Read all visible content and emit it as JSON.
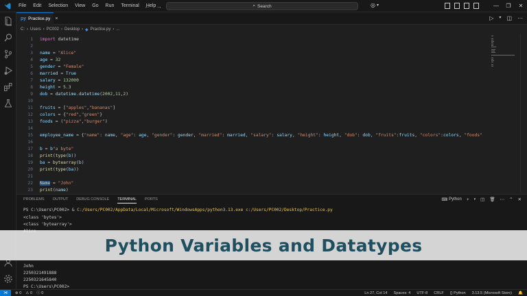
{
  "titlebar": {
    "menu": [
      "File",
      "Edit",
      "Selection",
      "View",
      "Go",
      "Run",
      "Terminal",
      "Help"
    ],
    "search_label": "Search"
  },
  "tab": {
    "label": "Practice.py",
    "icon_text": "py"
  },
  "breadcrumb": [
    "C:",
    "Users",
    "PC002",
    "Desktop",
    "Practice.py",
    "..."
  ],
  "editor": {
    "lines": [
      {
        "n": "1",
        "t": [
          [
            "kw",
            "import"
          ],
          [
            "code",
            " datetime"
          ]
        ]
      },
      {
        "n": "2",
        "t": []
      },
      {
        "n": "3",
        "t": [
          [
            "var",
            "name"
          ],
          [
            "code",
            " = "
          ],
          [
            "str",
            "\"Alice\""
          ]
        ]
      },
      {
        "n": "4",
        "t": [
          [
            "var",
            "age"
          ],
          [
            "code",
            " = "
          ],
          [
            "num",
            "32"
          ]
        ]
      },
      {
        "n": "5",
        "t": [
          [
            "var",
            "gender"
          ],
          [
            "code",
            " = "
          ],
          [
            "str",
            "\"Female\""
          ]
        ]
      },
      {
        "n": "6",
        "t": [
          [
            "var",
            "married"
          ],
          [
            "code",
            " = "
          ],
          [
            "var",
            "True"
          ]
        ]
      },
      {
        "n": "7",
        "t": [
          [
            "var",
            "salary"
          ],
          [
            "code",
            " = "
          ],
          [
            "num",
            "132000"
          ]
        ]
      },
      {
        "n": "8",
        "t": [
          [
            "var",
            "height"
          ],
          [
            "code",
            " = "
          ],
          [
            "num",
            "5.3"
          ]
        ]
      },
      {
        "n": "9",
        "t": [
          [
            "var",
            "dob"
          ],
          [
            "code",
            " = "
          ],
          [
            "var",
            "datetime"
          ],
          [
            "code",
            "."
          ],
          [
            "var",
            "datetime"
          ],
          [
            "code",
            "("
          ],
          [
            "num",
            "2002"
          ],
          [
            "code",
            ","
          ],
          [
            "num",
            "11"
          ],
          [
            "code",
            ","
          ],
          [
            "num",
            "2"
          ],
          [
            "code",
            ")"
          ]
        ]
      },
      {
        "n": "10",
        "t": []
      },
      {
        "n": "11",
        "t": [
          [
            "var",
            "fruits"
          ],
          [
            "code",
            " = ["
          ],
          [
            "str",
            "\"apples\""
          ],
          [
            "code",
            ","
          ],
          [
            "str",
            "\"bananas\""
          ],
          [
            "code",
            "]"
          ]
        ]
      },
      {
        "n": "12",
        "t": [
          [
            "var",
            "colors"
          ],
          [
            "code",
            " = {"
          ],
          [
            "str",
            "\"red\""
          ],
          [
            "code",
            ","
          ],
          [
            "str",
            "\"green\""
          ],
          [
            "code",
            "}"
          ]
        ]
      },
      {
        "n": "13",
        "t": [
          [
            "var",
            "foods"
          ],
          [
            "code",
            " = ("
          ],
          [
            "str",
            "\"pizza\""
          ],
          [
            "code",
            ","
          ],
          [
            "str",
            "\"burger\""
          ],
          [
            "code",
            ")"
          ]
        ]
      },
      {
        "n": "14",
        "t": []
      },
      {
        "n": "15",
        "t": [
          [
            "var",
            "employee_name"
          ],
          [
            "code",
            " = {"
          ],
          [
            "str",
            "\"name\""
          ],
          [
            "code",
            ": "
          ],
          [
            "var",
            "name"
          ],
          [
            "code",
            ", "
          ],
          [
            "str",
            "\"age\""
          ],
          [
            "code",
            ": "
          ],
          [
            "var",
            "age"
          ],
          [
            "code",
            ", "
          ],
          [
            "str",
            "\"gender\""
          ],
          [
            "code",
            ": "
          ],
          [
            "var",
            "gender"
          ],
          [
            "code",
            ", "
          ],
          [
            "str",
            "\"married\""
          ],
          [
            "code",
            ": "
          ],
          [
            "var",
            "married"
          ],
          [
            "code",
            ", "
          ],
          [
            "str",
            "\"salary\""
          ],
          [
            "code",
            ": "
          ],
          [
            "var",
            "salary"
          ],
          [
            "code",
            ", "
          ],
          [
            "str",
            "\"height\""
          ],
          [
            "code",
            ": "
          ],
          [
            "var",
            "height"
          ],
          [
            "code",
            ", "
          ],
          [
            "str",
            "\"dob\""
          ],
          [
            "code",
            ": "
          ],
          [
            "var",
            "dob"
          ],
          [
            "code",
            ", "
          ],
          [
            "str",
            "\"fruits\""
          ],
          [
            "code",
            ":"
          ],
          [
            "var",
            "fruits"
          ],
          [
            "code",
            ", "
          ],
          [
            "str",
            "\"colors\""
          ],
          [
            "code",
            ":"
          ],
          [
            "var",
            "colors"
          ],
          [
            "code",
            ", "
          ],
          [
            "str",
            "\"foods\""
          ]
        ]
      },
      {
        "n": "16",
        "t": []
      },
      {
        "n": "17",
        "t": [
          [
            "var",
            "b"
          ],
          [
            "code",
            " = "
          ],
          [
            "var",
            "b"
          ],
          [
            "str",
            "\"a byte\""
          ]
        ]
      },
      {
        "n": "18",
        "t": [
          [
            "fn",
            "print"
          ],
          [
            "code",
            "("
          ],
          [
            "fn",
            "type"
          ],
          [
            "code",
            "("
          ],
          [
            "var",
            "b"
          ],
          [
            "code",
            "))"
          ]
        ]
      },
      {
        "n": "19",
        "t": [
          [
            "var",
            "ba"
          ],
          [
            "code",
            " = "
          ],
          [
            "fn",
            "bytearray"
          ],
          [
            "code",
            "("
          ],
          [
            "var",
            "b"
          ],
          [
            "code",
            ")"
          ]
        ]
      },
      {
        "n": "20",
        "t": [
          [
            "fn",
            "print"
          ],
          [
            "code",
            "("
          ],
          [
            "fn",
            "type"
          ],
          [
            "code",
            "("
          ],
          [
            "var",
            "ba"
          ],
          [
            "code",
            "))"
          ]
        ]
      },
      {
        "n": "21",
        "t": []
      },
      {
        "n": "22",
        "t": [
          [
            "hl",
            "Name"
          ],
          [
            "code",
            " = "
          ],
          [
            "str",
            "\"John\""
          ]
        ]
      },
      {
        "n": "23",
        "t": [
          [
            "fn",
            "print"
          ],
          [
            "code",
            "("
          ],
          [
            "var",
            "name"
          ],
          [
            "code",
            ")"
          ]
        ]
      }
    ]
  },
  "panel": {
    "tabs": [
      "PROBLEMS",
      "OUTPUT",
      "DEBUG CONSOLE",
      "TERMINAL",
      "PORTS"
    ],
    "active_tab": "TERMINAL",
    "terminal_label": "Python",
    "terminal": {
      "prompt_line_a": "PS C:\\Users\\PC002> & ",
      "prompt_line_b": "C:/Users/PC002/AppData/Local/Microsoft/WindowsApps/python3.13.exe c:/Users/PC002/Desktop/Practice.py",
      "out1": "<class 'bytes'>",
      "out2": "<class 'bytearray'>",
      "out3": "Alice",
      "out4": "John",
      "out5": "2250321491888",
      "out6": "2250321645840",
      "out7": "PS C:\\Users\\PC002>"
    }
  },
  "banner": {
    "title": "Python Variables and Datatypes"
  },
  "statusbar": {
    "errors": "0",
    "warnings": "0",
    "info": "0",
    "position": "Ln 27, Col 14",
    "spaces": "Spaces: 4",
    "encoding": "UTF-8",
    "eol": "CRLF",
    "language": "Python",
    "interpreter": "3.13.5 (Microsoft Store)"
  },
  "colors": {
    "accent": "#0078d4",
    "banner_text": "#1f4e5f",
    "banner_bg": "#eeeeee"
  }
}
